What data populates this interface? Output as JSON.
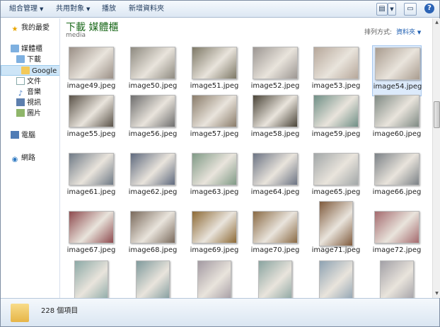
{
  "toolbar": {
    "organize": "組合管理",
    "share": "共用對象",
    "slideshow": "播放",
    "new_folder": "新增資料夾"
  },
  "nav": {
    "favorites": "我的最愛",
    "libraries": "媒體櫃",
    "downloads": "下載",
    "google": "Google I",
    "documents": "文件",
    "music": "音樂",
    "videos": "視訊",
    "pictures": "圖片",
    "computer": "電腦",
    "network": "網路"
  },
  "header": {
    "title": "下載 媒體櫃",
    "subtitle": "media",
    "arrange_label": "排列方式:",
    "arrange_value": "資料夾"
  },
  "files": [
    {
      "name": "image49.jpeg",
      "color": "#9a8f86"
    },
    {
      "name": "image50.jpeg",
      "color": "#8e8a80"
    },
    {
      "name": "image51.jpeg",
      "color": "#7d7866"
    },
    {
      "name": "image52.jpeg",
      "color": "#9c9692"
    },
    {
      "name": "image53.jpeg",
      "color": "#b6a79a"
    },
    {
      "name": "image54.jpeg",
      "color": "#a99c8f"
    },
    {
      "name": "image55.jpeg",
      "color": "#5a5248"
    },
    {
      "name": "image56.jpeg",
      "color": "#6e6e6e"
    },
    {
      "name": "image57.jpeg",
      "color": "#8a7c6a"
    },
    {
      "name": "image58.jpeg",
      "color": "#4a4438"
    },
    {
      "name": "image59.jpeg",
      "color": "#6f8f86"
    },
    {
      "name": "image60.jpeg",
      "color": "#7f8a84"
    },
    {
      "name": "image61.jpeg",
      "color": "#6f7a86"
    },
    {
      "name": "image62.jpeg",
      "color": "#5f6a7e"
    },
    {
      "name": "image63.jpeg",
      "color": "#809a86"
    },
    {
      "name": "image64.jpeg",
      "color": "#6c7484"
    },
    {
      "name": "image65.jpeg",
      "color": "#a2a7a8"
    },
    {
      "name": "image66.jpeg",
      "color": "#7c8287"
    },
    {
      "name": "image67.jpeg",
      "color": "#8e4a4e"
    },
    {
      "name": "image68.jpeg",
      "color": "#7a6a5c"
    },
    {
      "name": "image69.jpeg",
      "color": "#8d6a36"
    },
    {
      "name": "image70.jpeg",
      "color": "#8a6a44"
    },
    {
      "name": "image71.jpeg",
      "color": "#7f5a3c"
    },
    {
      "name": "image72.jpeg",
      "color": "#a46a6e"
    },
    {
      "name": "",
      "color": "#8ca9a6"
    },
    {
      "name": "",
      "color": "#7f9a9c"
    },
    {
      "name": "",
      "color": "#a39aa2"
    },
    {
      "name": "",
      "color": "#8aa4a0"
    },
    {
      "name": "",
      "color": "#8ea2b2"
    },
    {
      "name": "",
      "color": "#a2a0a6"
    }
  ],
  "status": {
    "count": "228 個項目"
  }
}
